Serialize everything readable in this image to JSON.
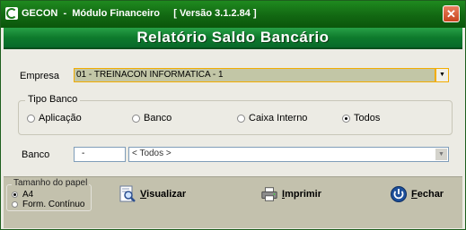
{
  "window": {
    "title": "GECON  -  Módulo Financeiro     [ Versão 3.1.2.84 ]",
    "close_glyph": "✕"
  },
  "banner": {
    "title": "Relatório Saldo Bancário"
  },
  "empresa": {
    "label": "Empresa",
    "value": "01 - TREINACON INFORMATICA - 1",
    "dropdown_glyph": "▼"
  },
  "tipo_banco": {
    "title": "Tipo Banco",
    "options": [
      {
        "label": "Aplicação",
        "selected": false
      },
      {
        "label": "Banco",
        "selected": false
      },
      {
        "label": "Caixa Interno",
        "selected": false
      },
      {
        "label": "Todos",
        "selected": true
      }
    ]
  },
  "banco": {
    "label": "Banco",
    "code": "-",
    "selected": "< Todos >",
    "dropdown_glyph": "▼"
  },
  "paper": {
    "title": "Tamanho do papel",
    "options": [
      {
        "label": "A4",
        "selected": true
      },
      {
        "label": "Form. Contínuo",
        "selected": false
      }
    ]
  },
  "buttons": {
    "visualizar": "Visualizar",
    "imprimir": "Imprimir",
    "fechar": "Fechar"
  },
  "colors": {
    "title_green": "#126812",
    "banner_green": "#0e7a2c",
    "field_highlight": "#c2c6a6",
    "focus_border": "#f2ac00",
    "footer_bg": "#c3c1ad"
  },
  "icons": {
    "app": "app-logo-icon",
    "close": "close-icon",
    "visualizar": "magnifier-document-icon",
    "imprimir": "printer-icon",
    "fechar": "power-icon"
  }
}
